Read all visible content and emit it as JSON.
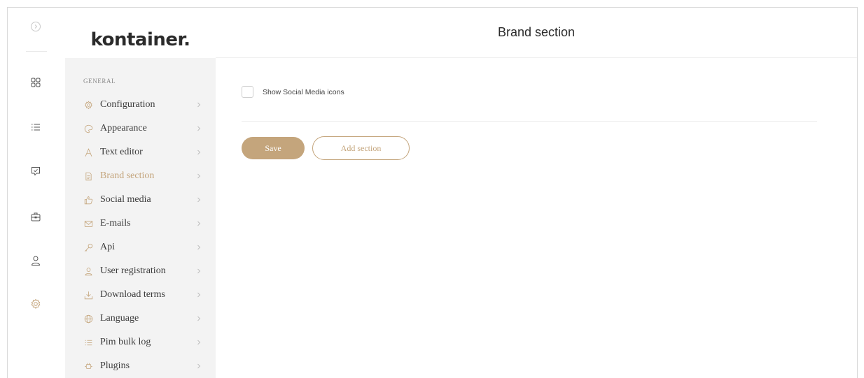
{
  "brand": {
    "logo_text": "kontainer.",
    "accent_color": "#c4a57c"
  },
  "rail": {
    "items": [
      {
        "icon": "chevron-right-circle-icon"
      },
      {
        "icon": "grid-icon"
      },
      {
        "icon": "list-icon"
      },
      {
        "icon": "chat-check-icon"
      },
      {
        "icon": "briefcase-icon"
      },
      {
        "icon": "user-icon"
      },
      {
        "icon": "gear-icon",
        "active": true
      }
    ]
  },
  "sidebar": {
    "section_label": "GENERAL",
    "items": [
      {
        "label": "Configuration",
        "icon": "gear-icon"
      },
      {
        "label": "Appearance",
        "icon": "palette-icon"
      },
      {
        "label": "Text editor",
        "icon": "text-icon"
      },
      {
        "label": "Brand section",
        "icon": "document-icon",
        "active": true
      },
      {
        "label": "Social media",
        "icon": "thumbs-up-icon"
      },
      {
        "label": "E-mails",
        "icon": "mail-icon"
      },
      {
        "label": "Api",
        "icon": "key-icon"
      },
      {
        "label": "User registration",
        "icon": "user-icon"
      },
      {
        "label": "Download terms",
        "icon": "download-icon"
      },
      {
        "label": "Language",
        "icon": "globe-icon"
      },
      {
        "label": "Pim bulk log",
        "icon": "list-icon"
      },
      {
        "label": "Plugins",
        "icon": "plugin-icon"
      }
    ]
  },
  "main": {
    "title": "Brand section",
    "checkbox_label": "Show Social Media icons",
    "save_label": "Save",
    "add_section_label": "Add section"
  }
}
